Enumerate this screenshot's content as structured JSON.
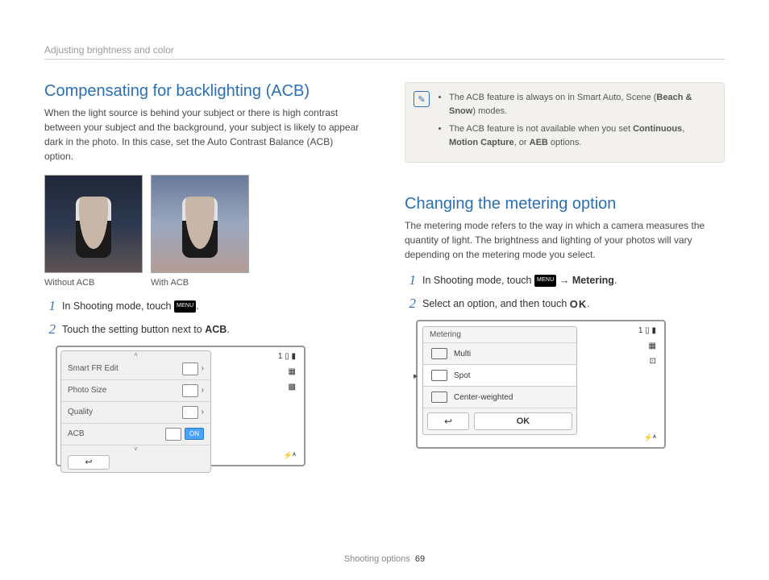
{
  "breadcrumb": "Adjusting brightness and color",
  "left": {
    "heading": "Compensating for backlighting (ACB)",
    "intro": "When the light source is behind your subject or there is high contrast between your subject and the background, your subject is likely to appear dark in the photo. In this case, set the Auto Contrast Balance (ACB) option.",
    "photo_without": "Without ACB",
    "photo_with": "With ACB",
    "step1_pre": "In Shooting mode, touch ",
    "step1_post": ".",
    "step2_pre": "Touch the setting button next to ",
    "step2_bold": "ACB",
    "step2_post": ".",
    "screen": {
      "row1": "Smart FR Edit",
      "row2": "Photo Size",
      "row3": "Quality",
      "row4": "ACB",
      "on": "ON",
      "count": "1"
    }
  },
  "right": {
    "note1_pre": "The ACB feature is always on in Smart Auto, Scene (",
    "note1_bold": "Beach & Snow",
    "note1_post": ") modes.",
    "note2_pre": "The ACB feature is not available when you set ",
    "note2_b1": "Continuous",
    "note2_sep1": ", ",
    "note2_b2": "Motion Capture",
    "note2_sep2": ", or ",
    "note2_b3": "AEB",
    "note2_post": " options.",
    "heading": "Changing the metering option",
    "intro": "The metering mode refers to the way in which a camera measures the quantity of light. The brightness and lighting of your photos will vary depending on the metering mode you select.",
    "step1_pre": "In Shooting mode, touch ",
    "step1_mid": " → ",
    "step1_bold": "Metering",
    "step1_post": ".",
    "step2_pre": "Select an option, and then touch ",
    "step2_post": ".",
    "screen": {
      "title": "Metering",
      "opt1": "Multi",
      "opt2": "Spot",
      "opt3": "Center-weighted",
      "ok": "OK",
      "count": "1"
    },
    "ok_label": "OK",
    "menu_label": "MENU"
  },
  "footer": {
    "section": "Shooting options",
    "page": "69"
  }
}
